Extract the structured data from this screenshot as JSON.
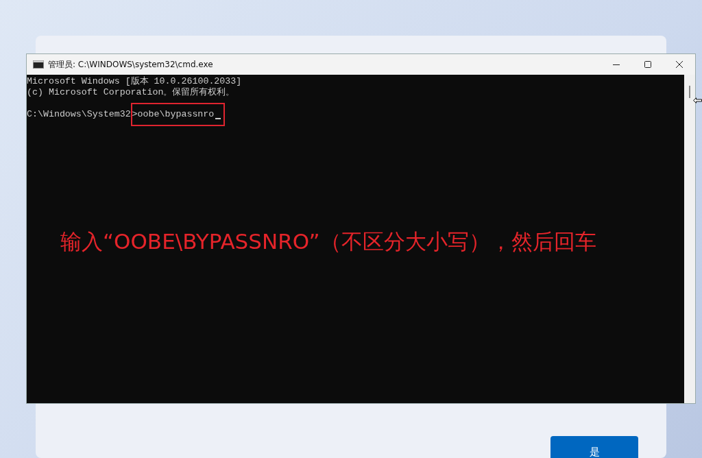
{
  "window": {
    "title": "管理员: C:\\WINDOWS\\system32\\cmd.exe"
  },
  "console": {
    "lines": [
      "Microsoft Windows [版本 10.0.26100.2033]",
      "(c) Microsoft Corporation。保留所有权利。"
    ],
    "prompt": "C:\\Windows\\System32",
    "command": ">oobe\\bypassnro",
    "highlighted": true
  },
  "annotation": "输入“OOBE\\BYPASSNRO”（不区分大小写），然后回车",
  "setup_page": {
    "buttons": [
      "是"
    ]
  }
}
